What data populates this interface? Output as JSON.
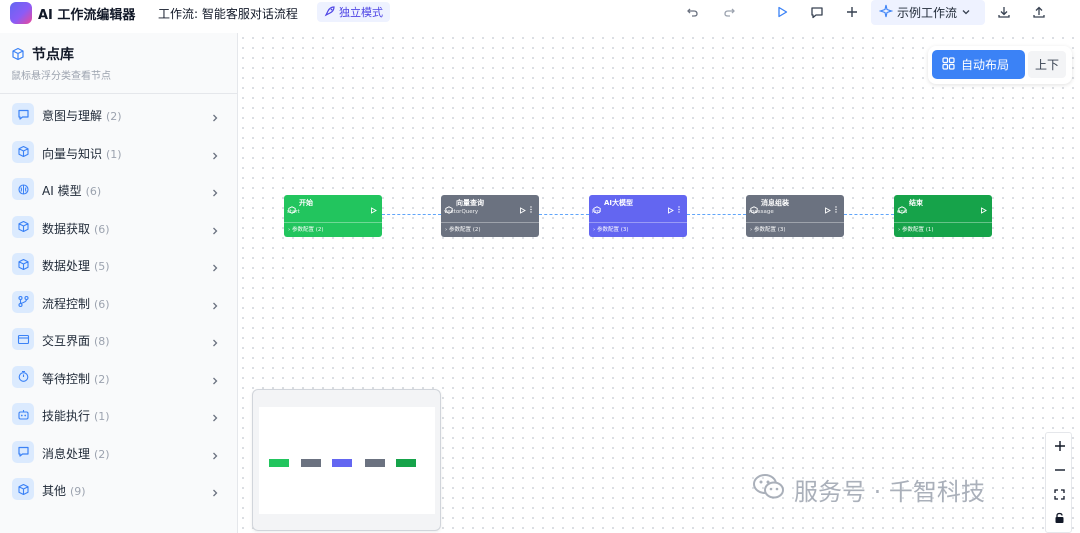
{
  "header": {
    "app_title": "AI 工作流编辑器",
    "workflow_label": "工作流: 智能客服对话流程",
    "mode_badge": "独立模式",
    "example_button": "示例工作流"
  },
  "sidebar": {
    "title": "节点库",
    "subtitle": "鼠标悬浮分类查看节点",
    "categories": [
      {
        "label": "意图与理解",
        "count": "(2)",
        "icon": "message-icon"
      },
      {
        "label": "向量与知识",
        "count": "(1)",
        "icon": "cube-icon"
      },
      {
        "label": "AI 模型",
        "count": "(6)",
        "icon": "brain-icon"
      },
      {
        "label": "数据获取",
        "count": "(6)",
        "icon": "cube-icon"
      },
      {
        "label": "数据处理",
        "count": "(5)",
        "icon": "cube-icon"
      },
      {
        "label": "流程控制",
        "count": "(6)",
        "icon": "branch-icon"
      },
      {
        "label": "交互界面",
        "count": "(8)",
        "icon": "window-icon"
      },
      {
        "label": "等待控制",
        "count": "(2)",
        "icon": "timer-icon"
      },
      {
        "label": "技能执行",
        "count": "(1)",
        "icon": "robot-icon"
      },
      {
        "label": "消息处理",
        "count": "(2)",
        "icon": "message-icon"
      },
      {
        "label": "其他",
        "count": "(9)",
        "icon": "cube-icon"
      }
    ]
  },
  "toolbar": {
    "auto_layout": "自动布局",
    "direction": "上下"
  },
  "nodes": [
    {
      "title": "开始",
      "type": "start",
      "params": "参数配置 (2)",
      "color": "#22c55e"
    },
    {
      "title": "向量查询",
      "type": "vectorQuery",
      "params": "参数配置 (2)",
      "color": "#6b7280"
    },
    {
      "title": "AI大模型",
      "type": "llm",
      "params": "参数配置 (3)",
      "color": "#6366f1"
    },
    {
      "title": "消息组装",
      "type": "message",
      "params": "参数配置 (3)",
      "color": "#6b7280"
    },
    {
      "title": "结束",
      "type": "end",
      "params": "参数配置 (1)",
      "color": "#16a34a"
    }
  ],
  "watermark": "服务号 · 千智科技"
}
